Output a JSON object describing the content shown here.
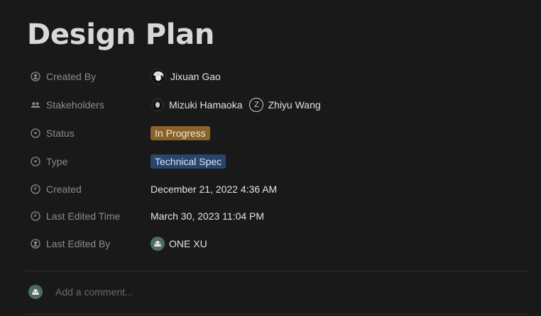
{
  "page": {
    "title": "Design Plan"
  },
  "properties": {
    "created_by": {
      "label": "Created By",
      "person": "Jixuan Gao"
    },
    "stakeholders": {
      "label": "Stakeholders",
      "people": [
        "Mizuki Hamaoka",
        "Zhiyu Wang"
      ],
      "initial": "Z"
    },
    "status": {
      "label": "Status",
      "value": "In Progress",
      "color": "#89632a"
    },
    "type": {
      "label": "Type",
      "value": "Technical Spec",
      "color": "#28456c"
    },
    "created": {
      "label": "Created",
      "value": "December 21, 2022 4:36 AM"
    },
    "last_edited_time": {
      "label": "Last Edited Time",
      "value": "March 30, 2023 11:04 PM"
    },
    "last_edited_by": {
      "label": "Last Edited By",
      "person": "ONE XU"
    }
  },
  "comment": {
    "placeholder": "Add a comment..."
  },
  "icons": {
    "created_by": "person-circle-icon",
    "stakeholders": "people-icon",
    "status": "select-circle-icon",
    "type": "select-circle-icon",
    "created": "clock-icon",
    "last_edited_time": "clock-icon",
    "last_edited_by": "person-circle-icon"
  }
}
